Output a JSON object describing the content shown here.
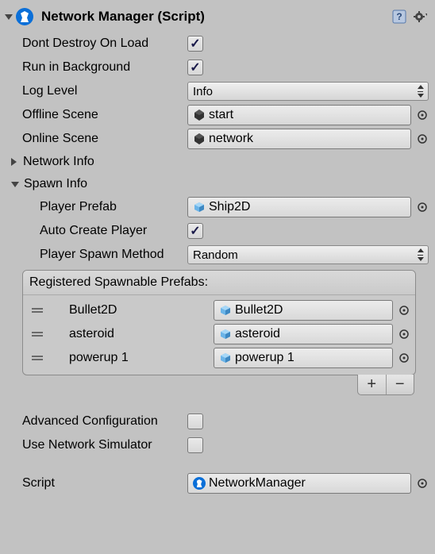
{
  "header": {
    "title": "Network Manager (Script)"
  },
  "fields": {
    "dontDestroy": {
      "label": "Dont Destroy On Load",
      "value": true
    },
    "runInBg": {
      "label": "Run in Background",
      "value": true
    },
    "logLevel": {
      "label": "Log Level",
      "value": "Info"
    },
    "offlineScene": {
      "label": "Offline Scene",
      "value": "start"
    },
    "onlineScene": {
      "label": "Online Scene",
      "value": "network"
    },
    "playerPrefab": {
      "label": "Player Prefab",
      "value": "Ship2D"
    },
    "autoCreate": {
      "label": "Auto Create Player",
      "value": true
    },
    "spawnMethod": {
      "label": "Player Spawn Method",
      "value": "Random"
    },
    "advanced": {
      "label": "Advanced Configuration",
      "value": false
    },
    "simulator": {
      "label": "Use Network Simulator",
      "value": false
    },
    "script": {
      "label": "Script",
      "value": "NetworkManager"
    }
  },
  "sections": {
    "networkInfo": "Network Info",
    "spawnInfo": "Spawn Info"
  },
  "spawnList": {
    "header": "Registered Spawnable Prefabs:",
    "items": [
      {
        "name": "Bullet2D",
        "value": "Bullet2D"
      },
      {
        "name": "asteroid",
        "value": "asteroid"
      },
      {
        "name": "powerup 1",
        "value": "powerup 1"
      }
    ]
  }
}
